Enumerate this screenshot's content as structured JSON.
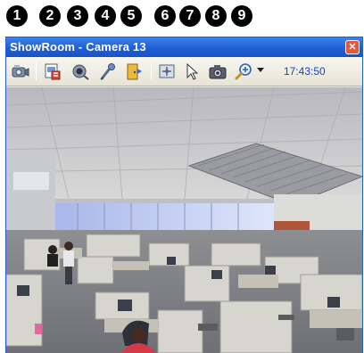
{
  "callouts": [
    "1",
    "2",
    "3",
    "4",
    "5",
    "6",
    "7",
    "8",
    "9"
  ],
  "window": {
    "title": "ShowRoom - Camera 13",
    "close_glyph": "✕"
  },
  "toolbar": {
    "buttons": [
      {
        "name": "camera-select-icon"
      },
      {
        "name": "snapshot-layout-icon"
      },
      {
        "name": "record-icon"
      },
      {
        "name": "audio-microphone-icon"
      },
      {
        "name": "door-output-icon"
      },
      {
        "name": "ptz-control-icon"
      },
      {
        "name": "pointer-cursor-icon"
      },
      {
        "name": "camera-snapshot-icon"
      },
      {
        "name": "zoom-icon"
      }
    ],
    "clock": "17:43:50"
  },
  "colors": {
    "titlebar": "#1f5fd6",
    "clock": "#1a3fd0",
    "callout": "#000000"
  }
}
